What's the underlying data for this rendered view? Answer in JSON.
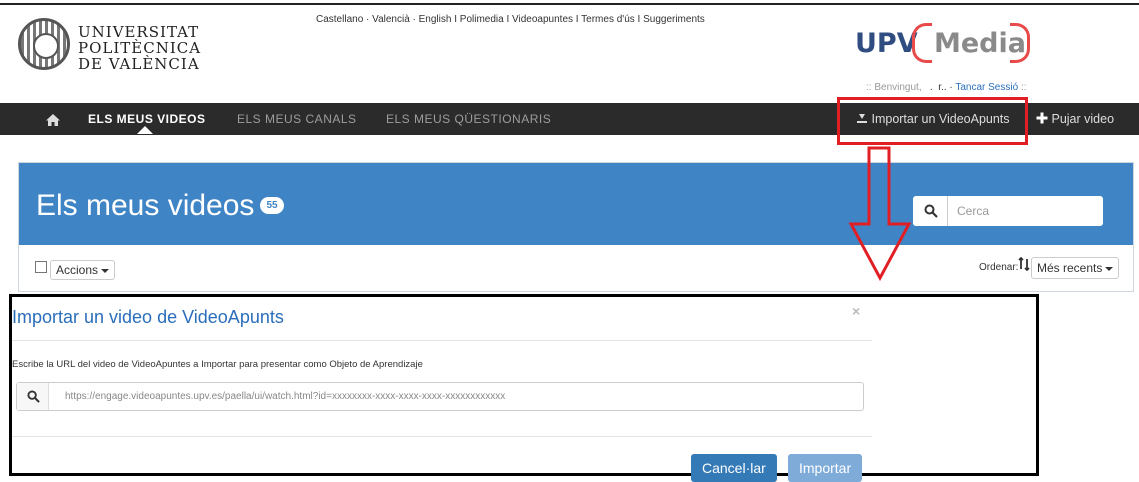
{
  "header": {
    "university_name_lines": [
      "UNIVERSITAT",
      "POLITÈCNICA",
      "DE VALÈNCIA"
    ],
    "top_links": "Castellano · Valencià · English I Polimedia I Videoapuntes I Termes d'ús I Suggeriments",
    "brand_left": "UPV",
    "brand_right": "Media",
    "welcome_prefix": ":: Benvingut,",
    "welcome_user": "  .  r..",
    "welcome_separator": "·",
    "logout_label": "Tancar Sessió",
    "welcome_suffix": "::"
  },
  "navbar": {
    "items": [
      {
        "label": "ELS MEUS VIDEOS",
        "active": true
      },
      {
        "label": "ELS MEUS CANALS",
        "active": false
      },
      {
        "label": "ELS MEUS QÜESTIONARIS",
        "active": false
      }
    ],
    "import_label": "Importar un VideoApunts",
    "upload_label": "Pujar video"
  },
  "panel": {
    "title": "Els meus videos",
    "count": "55",
    "search_placeholder": "Cerca",
    "actions_label": "Accions",
    "order_label": "Ordenar:",
    "order_value": "Més recents"
  },
  "modal": {
    "title": "Importar un video de VideoApunts",
    "close_symbol": "×",
    "description": "Escribe la URL del video de VideoApuntes a Importar para presentar como Objeto de Aprendizaje",
    "url_placeholder": "https://engage.videoapuntes.upv.es/paella/ui/watch.html?id=xxxxxxxx-xxxx-xxxx-xxxx-xxxxxxxxxxxx",
    "cancel_label": "Cancel·lar",
    "import_label": "Importar"
  },
  "colors": {
    "navbar_bg": "#2b2b2b",
    "panel_header": "#3f85c6",
    "annotation_red": "#e21e25",
    "link_blue": "#2a6ebb",
    "button_primary": "#337ab7",
    "button_disabled": "#7fabd8"
  },
  "icons": [
    "home-icon",
    "search-icon",
    "import-icon",
    "plus-icon",
    "sort-icon",
    "caret-down-icon",
    "close-icon"
  ]
}
